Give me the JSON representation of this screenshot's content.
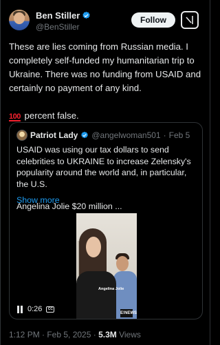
{
  "author": {
    "display_name": "Ben Stiller",
    "handle": "@BenStiller"
  },
  "actions": {
    "follow_label": "Follow",
    "grok_icon": "grok-icon"
  },
  "tweet": {
    "paragraph1": "These are lies coming from Russian media. I completely self-funded my humanitarian trip to Ukraine. There was no funding from USAID and certainly no payment of any kind.",
    "emoji_100": "100",
    "paragraph2": " percent false."
  },
  "quote": {
    "display_name": "Patriot Lady",
    "handle": "@angelwoman501",
    "separator": "·",
    "date": "Feb 5",
    "paragraph1": "USAID was using our tax dollars to send celebrities to UKRAINE to increase Zelensky's popularity around the world and, in particular, the U.S.",
    "paragraph2": "Angelina Jolie $20 million ...",
    "show_more": "Show more",
    "video": {
      "caption": "Angelina Jolie",
      "logo": "E!NEWS",
      "time": "0:26",
      "cc": "CC"
    }
  },
  "footer": {
    "timestamp": "1:12 PM · Feb 5, 2025 · ",
    "views_count": "5.3M",
    "views_label": " Views"
  },
  "colors": {
    "background": "#000000",
    "text": "#e7e9ea",
    "muted": "#71767b",
    "link": "#1d9bf0",
    "verified": "#1d9bf0",
    "border": "#2f3336"
  }
}
